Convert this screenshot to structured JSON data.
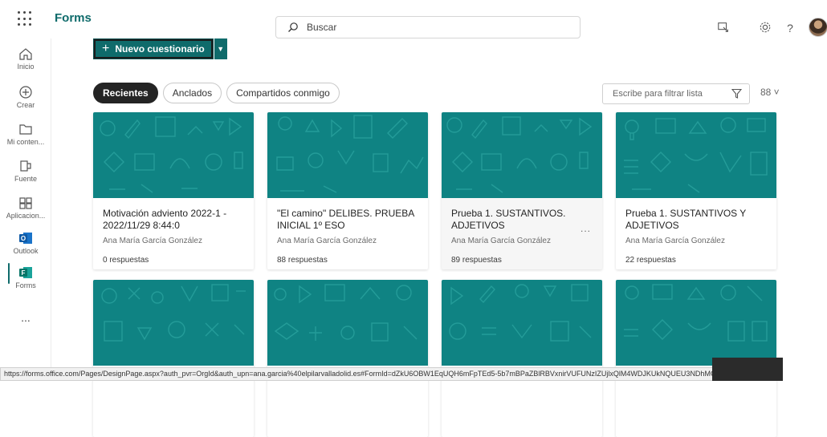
{
  "header": {
    "app_name": "Forms",
    "search_placeholder": "Buscar",
    "help_label": "?"
  },
  "rail": {
    "items": [
      {
        "label": "Inicio",
        "icon": "home-icon"
      },
      {
        "label": "Crear",
        "icon": "add-circle-icon"
      },
      {
        "label": "Mi conten...",
        "icon": "folder-icon"
      },
      {
        "label": "Fuente",
        "icon": "feed-icon"
      },
      {
        "label": "Aplicacion...",
        "icon": "apps-icon"
      },
      {
        "label": "Outlook",
        "icon": "outlook-icon"
      },
      {
        "label": "Forms",
        "icon": "forms-icon"
      },
      {
        "label": "...",
        "icon": "more-icon"
      }
    ]
  },
  "new_button": {
    "label": "Nuevo cuestionario"
  },
  "tabs": [
    {
      "label": "Recientes",
      "active": true
    },
    {
      "label": "Anclados",
      "active": false
    },
    {
      "label": "Compartidos conmigo",
      "active": false
    }
  ],
  "filter": {
    "placeholder": "Escribe para filtrar lista"
  },
  "view_toggle": {
    "label": "88 ˅"
  },
  "cards": [
    {
      "title": "Motivación adviento 2022-1 - 2022/11/29 8:44:0",
      "author": "Ana María García González",
      "responses": "0 respuestas"
    },
    {
      "title": "\"El camino\" DELIBES. PRUEBA INICIAL 1º ESO",
      "author": "Ana María García González",
      "responses": "88 respuestas"
    },
    {
      "title": "Prueba 1. SUSTANTIVOS. ADJETIVOS",
      "author": "Ana María García González",
      "responses": "89 respuestas",
      "more": "..."
    },
    {
      "title": "Prueba 1. SUSTANTIVOS Y ADJETIVOS",
      "author": "Ana María García González",
      "responses": "22 respuestas"
    }
  ],
  "colors": {
    "accent": "#0f6b6b",
    "card_thumb": "#0f8383"
  },
  "status_url": "https://forms.office.com/Pages/DesignPage.aspx?auth_pvr=OrgId&auth_upn=ana.garcia%40elpilarvalladolid.es#FormId=dZkU6OBW1EqUQH6mFpTEd5-5b7mBPaZBlRBVxnirVUFUNzIZUjlxQlM4WDJKUkNQUEU3NDhMOFcyTC4u"
}
